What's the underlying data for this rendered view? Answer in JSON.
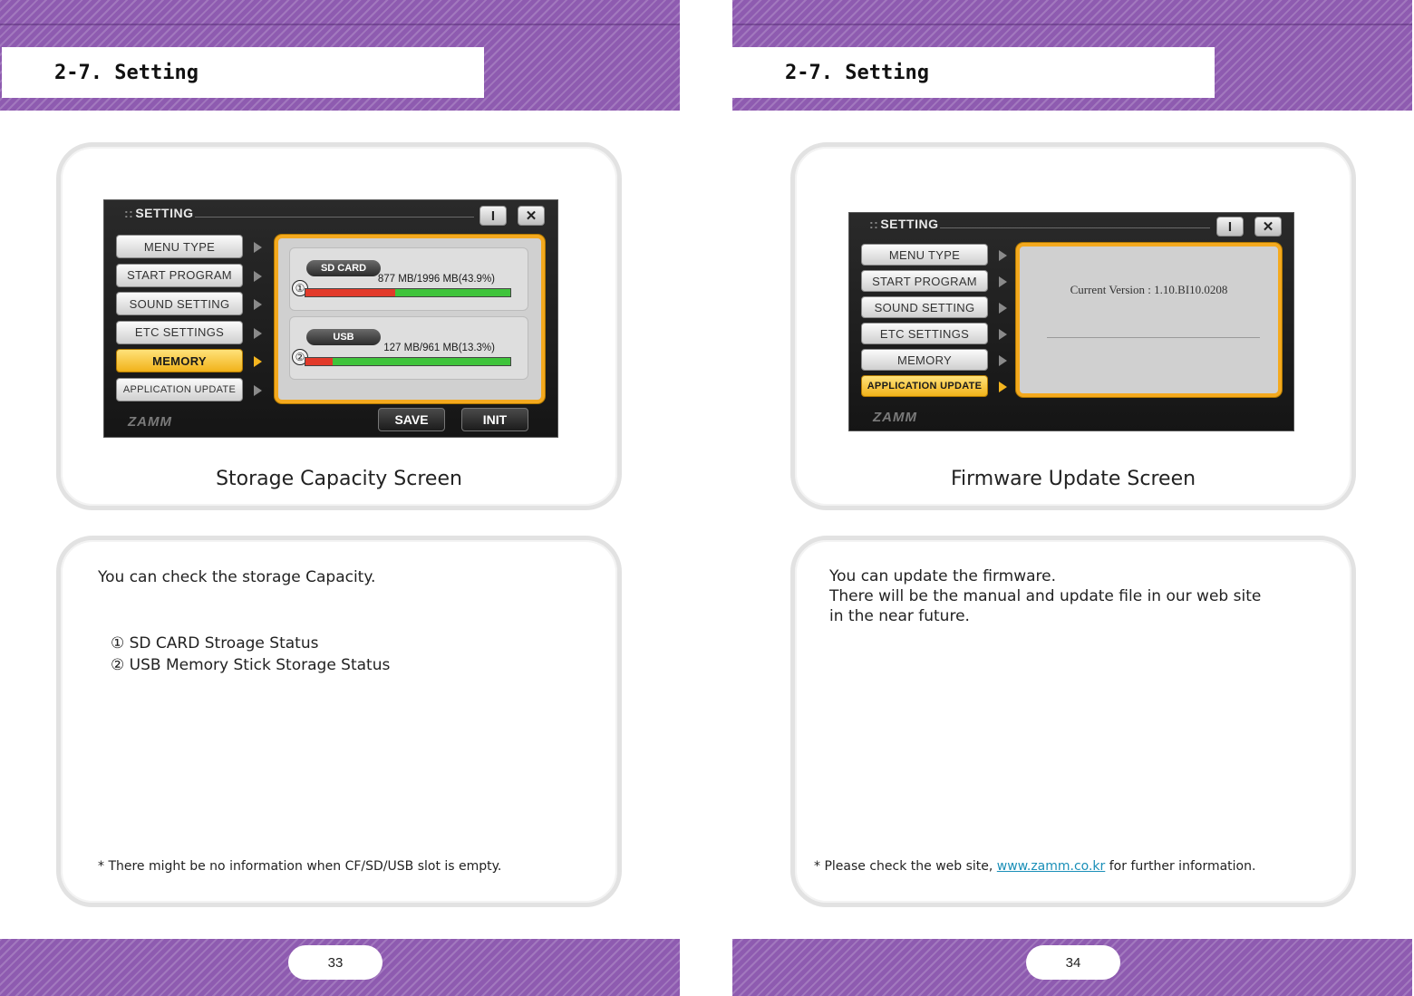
{
  "left_page": {
    "header_title": "2-7. Setting",
    "device": {
      "window_title": "SETTING",
      "info_button": "I",
      "close_button": "✕",
      "menu_items": [
        "MENU TYPE",
        "START PROGRAM",
        "SOUND SETTING",
        "ETC SETTINGS",
        "MEMORY",
        "APPLICATION UPDATE"
      ],
      "active_item": "MEMORY",
      "memory": [
        {
          "marker": "①",
          "label": "SD CARD",
          "usage": "877 MB/1996 MB(43.9%)",
          "percent": 43.9
        },
        {
          "marker": "②",
          "label": "USB",
          "usage": "127 MB/961 MB(13.3%)",
          "percent": 13.3
        }
      ],
      "brand": "ZAMM",
      "save_button": "SAVE",
      "init_button": "INIT"
    },
    "caption": "Storage Capacity Screen",
    "description": "You can check the storage Capacity.",
    "list_items": [
      "① SD CARD Stroage Status",
      "② USB Memory Stick Storage Status"
    ],
    "note": "* There might be no information when CF/SD/USB slot is empty.",
    "page_number": "33"
  },
  "right_page": {
    "header_title": "2-7. Setting",
    "device": {
      "window_title": "SETTING",
      "info_button": "I",
      "close_button": "✕",
      "menu_items": [
        "MENU TYPE",
        "START PROGRAM",
        "SOUND SETTING",
        "ETC SETTINGS",
        "MEMORY",
        "APPLICATION UPDATE"
      ],
      "active_item": "APPLICATION UPDATE",
      "version_text": "Current  Version :  1.10.BI10.0208",
      "brand": "ZAMM"
    },
    "caption": "Firmware Update Screen",
    "description_lines": [
      "You can update the firmware.",
      "There will be the manual and update file in our web site",
      "in the near future."
    ],
    "note_prefix": "* Please check the web site, ",
    "note_link": "www.zamm.co.kr",
    "note_suffix": " for further information.",
    "page_number": "34"
  },
  "colors": {
    "stripe_purple": "#8e5bb0",
    "highlight_orange": "#f4a91e",
    "bar_used_red": "#e23a2a",
    "bar_free_green": "#3fc43b",
    "link_teal": "#1a8fb8"
  },
  "icons": [
    "menu-arrow-icon",
    "info-icon",
    "close-icon"
  ]
}
